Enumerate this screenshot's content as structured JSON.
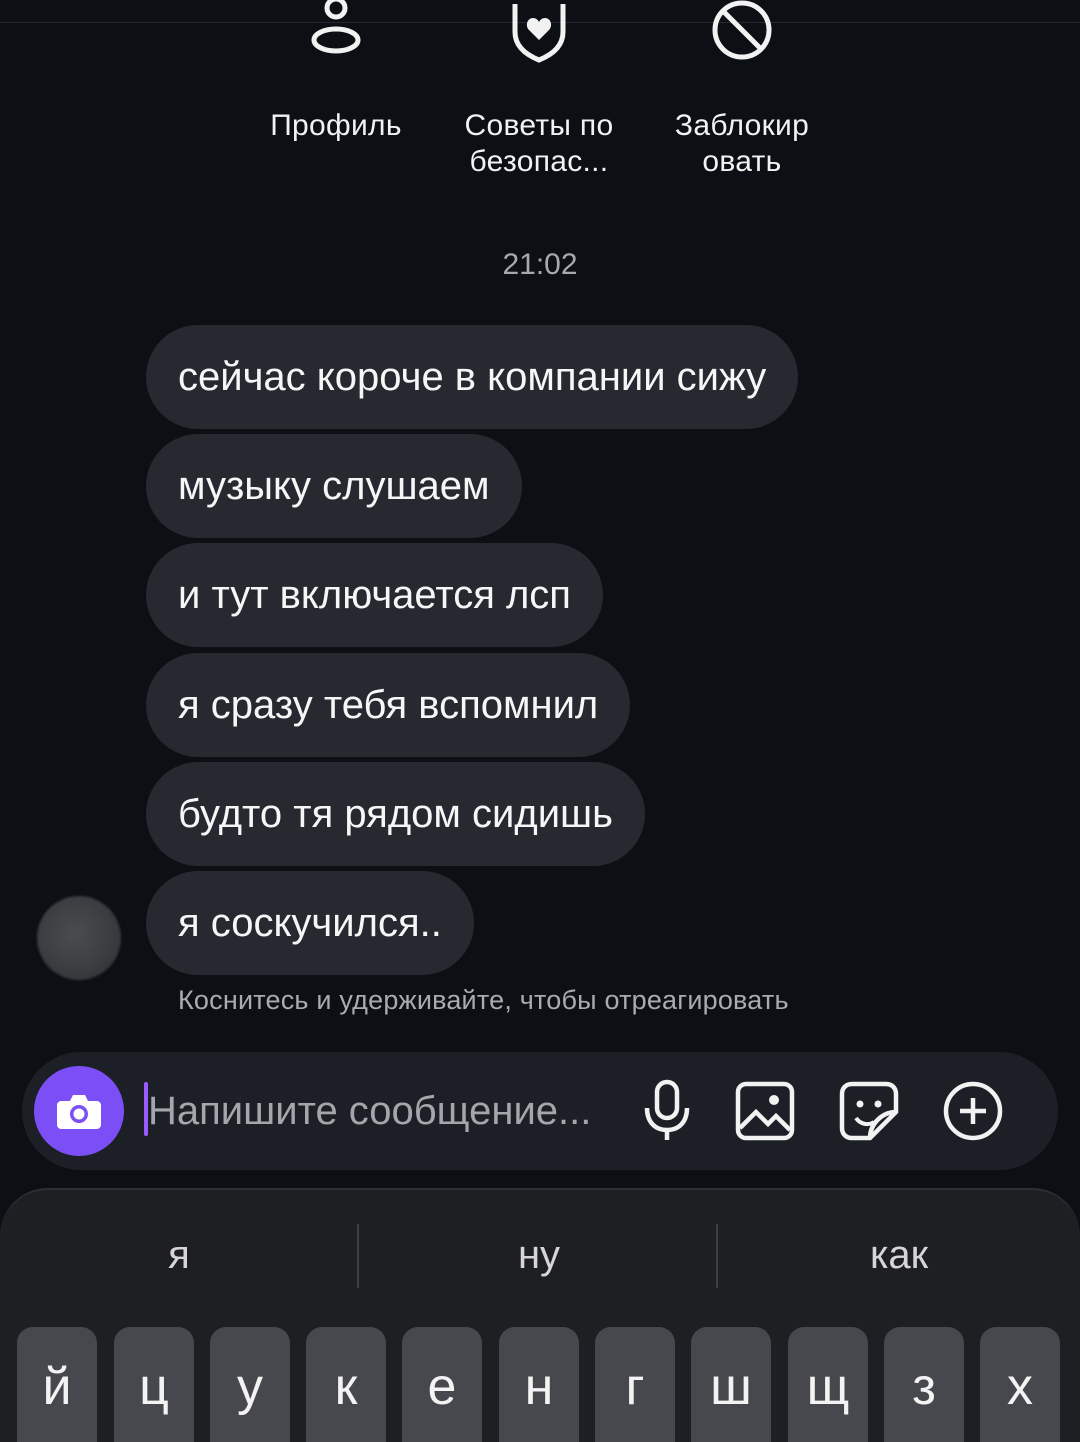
{
  "actions": [
    {
      "label_line1": "Профиль",
      "label_line2": "",
      "icon": "person-icon"
    },
    {
      "label_line1": "Советы по",
      "label_line2": "безопас...",
      "icon": "shield-icon"
    },
    {
      "label_line1": "Заблокир",
      "label_line2": "овать",
      "icon": "block-icon"
    }
  ],
  "timestamp": "21:02",
  "messages": [
    "сейчас короче в компании сижу",
    "музыку слушаем",
    "и тут включается лсп",
    "я сразу тебя вспомнил",
    "будто тя рядом сидишь",
    "я соскучился.."
  ],
  "hint": "Коснитесь и удерживайте, чтобы отреагировать",
  "composer": {
    "placeholder": "Напишите сообщение...",
    "accent_color": "#7b4ff5",
    "icons": [
      "camera-icon",
      "microphone-icon",
      "gallery-icon",
      "sticker-icon",
      "plus-circle-icon"
    ]
  },
  "keyboard": {
    "suggestions": [
      "я",
      "ну",
      "как"
    ],
    "keys": [
      "й",
      "ц",
      "у",
      "к",
      "е",
      "н",
      "г",
      "ш",
      "щ",
      "з",
      "х"
    ]
  }
}
